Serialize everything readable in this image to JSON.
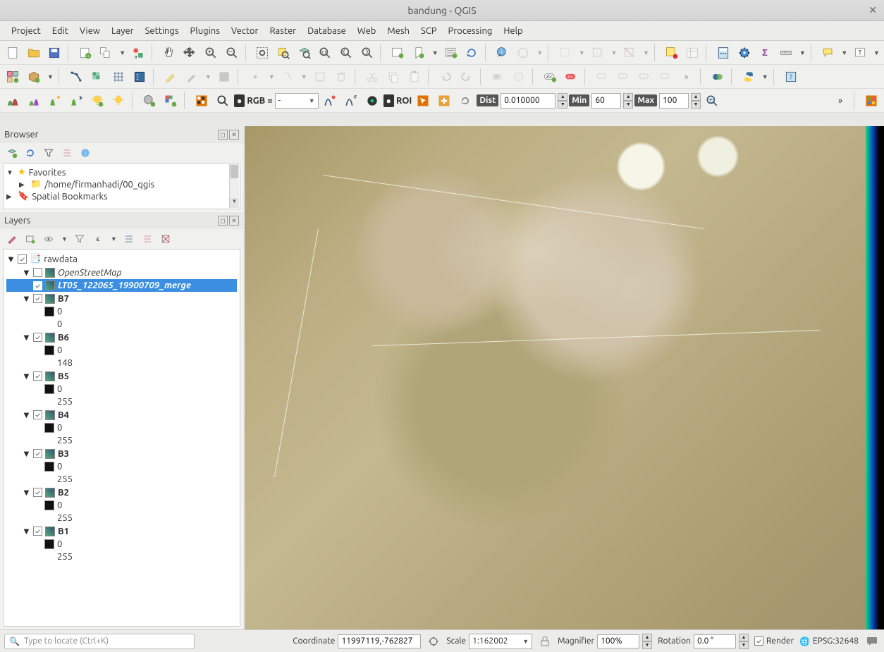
{
  "window": {
    "title": "bandung - QGIS"
  },
  "menus": [
    "Project",
    "Edit",
    "View",
    "Layer",
    "Settings",
    "Plugins",
    "Vector",
    "Raster",
    "Database",
    "Web",
    "Mesh",
    "SCP",
    "Processing",
    "Help"
  ],
  "browser": {
    "title": "Browser",
    "items": {
      "favorites": "Favorites",
      "path": "/home/firmanhadi/00_qgis",
      "bookmarks": "Spatial Bookmarks"
    }
  },
  "layers": {
    "title": "Layers",
    "group": "rawdata",
    "osm": "OpenStreetMap",
    "selected": "LT05_122065_19900709_merge",
    "bands": [
      {
        "name": "B7",
        "lo": "0",
        "hi": "0"
      },
      {
        "name": "B6",
        "lo": "0",
        "hi": "148"
      },
      {
        "name": "B5",
        "lo": "0",
        "hi": "255"
      },
      {
        "name": "B4",
        "lo": "0",
        "hi": "255"
      },
      {
        "name": "B3",
        "lo": "0",
        "hi": "255"
      },
      {
        "name": "B2",
        "lo": "0",
        "hi": "255"
      },
      {
        "name": "B1",
        "lo": "0",
        "hi": "255"
      }
    ]
  },
  "scp": {
    "rgb_label": "RGB =",
    "rgb_value": "-",
    "roi_label": "ROI",
    "dist_label": "Dist",
    "dist_value": "0.010000",
    "min_label": "Min",
    "min_value": "60",
    "max_label": "Max",
    "max_value": "100"
  },
  "status": {
    "search_placeholder": "Type to locate (Ctrl+K)",
    "coord_label": "Coordinate",
    "coord_value": "11997119,-762827",
    "scale_label": "Scale",
    "scale_value": "1:162002",
    "mag_label": "Magnifier",
    "mag_value": "100%",
    "rot_label": "Rotation",
    "rot_value": "0.0 °",
    "render_label": "Render",
    "crs": "EPSG:32648"
  }
}
